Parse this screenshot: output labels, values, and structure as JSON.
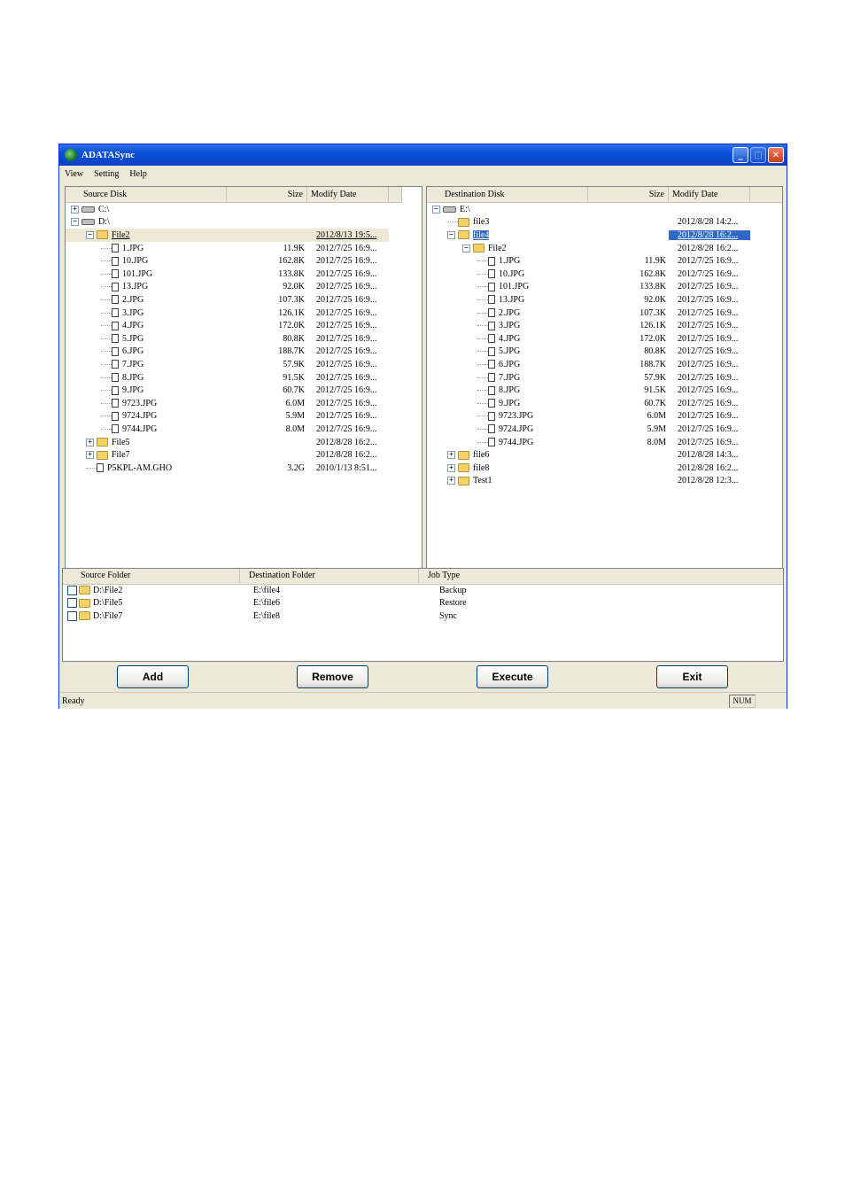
{
  "window": {
    "title": "ADATASync",
    "controls": [
      "minimize-icon",
      "maximize-icon",
      "close-icon"
    ]
  },
  "menu": [
    "View",
    "Setting",
    "Help"
  ],
  "source": {
    "columns": [
      "Source Disk",
      "Size",
      "Modify Date"
    ],
    "rows": [
      {
        "depth": 0,
        "type": "drive",
        "exp": "+",
        "name": "C:\\",
        "size": "",
        "date": ""
      },
      {
        "depth": 0,
        "type": "drive",
        "exp": "−",
        "name": "D:\\",
        "size": "",
        "date": ""
      },
      {
        "depth": 1,
        "type": "folder-open",
        "exp": "−",
        "name": "File2",
        "size": "",
        "date": "2012/8/13 19:5...",
        "style": "selected"
      },
      {
        "depth": 2,
        "type": "file",
        "name": "1.JPG",
        "size": "11.9K",
        "date": "2012/7/25 16:9..."
      },
      {
        "depth": 2,
        "type": "file",
        "name": "10.JPG",
        "size": "162.8K",
        "date": "2012/7/25 16:9..."
      },
      {
        "depth": 2,
        "type": "file",
        "name": "101.JPG",
        "size": "133.8K",
        "date": "2012/7/25 16:9..."
      },
      {
        "depth": 2,
        "type": "file",
        "name": "13.JPG",
        "size": "92.0K",
        "date": "2012/7/25 16:9..."
      },
      {
        "depth": 2,
        "type": "file",
        "name": "2.JPG",
        "size": "107.3K",
        "date": "2012/7/25 16:9..."
      },
      {
        "depth": 2,
        "type": "file",
        "name": "3.JPG",
        "size": "126.1K",
        "date": "2012/7/25 16:9..."
      },
      {
        "depth": 2,
        "type": "file",
        "name": "4.JPG",
        "size": "172.0K",
        "date": "2012/7/25 16:9..."
      },
      {
        "depth": 2,
        "type": "file",
        "name": "5.JPG",
        "size": "80.8K",
        "date": "2012/7/25 16:9..."
      },
      {
        "depth": 2,
        "type": "file",
        "name": "6.JPG",
        "size": "188.7K",
        "date": "2012/7/25 16:9..."
      },
      {
        "depth": 2,
        "type": "file",
        "name": "7.JPG",
        "size": "57.9K",
        "date": "2012/7/25 16:9..."
      },
      {
        "depth": 2,
        "type": "file",
        "name": "8.JPG",
        "size": "91.5K",
        "date": "2012/7/25 16:9..."
      },
      {
        "depth": 2,
        "type": "file",
        "name": "9.JPG",
        "size": "60.7K",
        "date": "2012/7/25 16:9..."
      },
      {
        "depth": 2,
        "type": "file",
        "name": "9723.JPG",
        "size": "6.0M",
        "date": "2012/7/25 16:9..."
      },
      {
        "depth": 2,
        "type": "file",
        "name": "9724.JPG",
        "size": "5.9M",
        "date": "2012/7/25 16:9..."
      },
      {
        "depth": 2,
        "type": "file",
        "name": "9744.JPG",
        "size": "8.0M",
        "date": "2012/7/25 16:9..."
      },
      {
        "depth": 1,
        "type": "folder",
        "exp": "+",
        "name": "File5",
        "size": "",
        "date": "2012/8/28 16:2..."
      },
      {
        "depth": 1,
        "type": "folder",
        "exp": "+",
        "name": "File7",
        "size": "",
        "date": "2012/8/28 16:2..."
      },
      {
        "depth": 1,
        "type": "file",
        "name": "P5KPL-AM.GHO",
        "size": "3.2G",
        "date": "2010/1/13 8:51..."
      }
    ]
  },
  "destination": {
    "columns": [
      "Destination Disk",
      "Size",
      "Modify Date"
    ],
    "rows": [
      {
        "depth": 0,
        "type": "drive",
        "exp": "−",
        "name": "E:\\",
        "size": "",
        "date": ""
      },
      {
        "depth": 1,
        "type": "folder",
        "name": "file3",
        "size": "",
        "date": "2012/8/28 14:2..."
      },
      {
        "depth": 1,
        "type": "folder-open",
        "exp": "−",
        "name": "file4",
        "size": "",
        "date": "2012/8/28 16:2...",
        "style": "highlighted"
      },
      {
        "depth": 2,
        "type": "folder",
        "exp": "−",
        "name": "File2",
        "size": "",
        "date": "2012/8/28 16:2..."
      },
      {
        "depth": 3,
        "type": "file",
        "name": "1.JPG",
        "size": "11.9K",
        "date": "2012/7/25 16:9..."
      },
      {
        "depth": 3,
        "type": "file",
        "name": "10.JPG",
        "size": "162.8K",
        "date": "2012/7/25 16:9..."
      },
      {
        "depth": 3,
        "type": "file",
        "name": "101.JPG",
        "size": "133.8K",
        "date": "2012/7/25 16:9..."
      },
      {
        "depth": 3,
        "type": "file",
        "name": "13.JPG",
        "size": "92.0K",
        "date": "2012/7/25 16:9..."
      },
      {
        "depth": 3,
        "type": "file",
        "name": "2.JPG",
        "size": "107.3K",
        "date": "2012/7/25 16:9..."
      },
      {
        "depth": 3,
        "type": "file",
        "name": "3.JPG",
        "size": "126.1K",
        "date": "2012/7/25 16:9..."
      },
      {
        "depth": 3,
        "type": "file",
        "name": "4.JPG",
        "size": "172.0K",
        "date": "2012/7/25 16:9..."
      },
      {
        "depth": 3,
        "type": "file",
        "name": "5.JPG",
        "size": "80.8K",
        "date": "2012/7/25 16:9..."
      },
      {
        "depth": 3,
        "type": "file",
        "name": "6.JPG",
        "size": "188.7K",
        "date": "2012/7/25 16:9..."
      },
      {
        "depth": 3,
        "type": "file",
        "name": "7.JPG",
        "size": "57.9K",
        "date": "2012/7/25 16:9..."
      },
      {
        "depth": 3,
        "type": "file",
        "name": "8.JPG",
        "size": "91.5K",
        "date": "2012/7/25 16:9..."
      },
      {
        "depth": 3,
        "type": "file",
        "name": "9.JPG",
        "size": "60.7K",
        "date": "2012/7/25 16:9..."
      },
      {
        "depth": 3,
        "type": "file",
        "name": "9723.JPG",
        "size": "6.0M",
        "date": "2012/7/25 16:9..."
      },
      {
        "depth": 3,
        "type": "file",
        "name": "9724.JPG",
        "size": "5.9M",
        "date": "2012/7/25 16:9..."
      },
      {
        "depth": 3,
        "type": "file",
        "name": "9744.JPG",
        "size": "8.0M",
        "date": "2012/7/25 16:9..."
      },
      {
        "depth": 1,
        "type": "folder",
        "exp": "+",
        "name": "file6",
        "size": "",
        "date": "2012/8/28 14:3..."
      },
      {
        "depth": 1,
        "type": "folder",
        "exp": "+",
        "name": "file8",
        "size": "",
        "date": "2012/8/28 16:2..."
      },
      {
        "depth": 1,
        "type": "folder",
        "exp": "+",
        "name": "Test1",
        "size": "",
        "date": "2012/8/28 12:3..."
      }
    ]
  },
  "jobs": {
    "columns": [
      "Source Folder",
      "Destination Folder",
      "Job Type"
    ],
    "rows": [
      {
        "source": "D:\\File2",
        "dest": "E:\\file4",
        "type": "Backup"
      },
      {
        "source": "D:\\File5",
        "dest": "E:\\file6",
        "type": "Restore"
      },
      {
        "source": "D:\\File7",
        "dest": "E:\\file8",
        "type": "Sync"
      }
    ]
  },
  "buttons": {
    "add": "Add",
    "remove": "Remove",
    "execute": "Execute",
    "exit": "Exit"
  },
  "status": {
    "text": "Ready",
    "num": "NUM"
  }
}
